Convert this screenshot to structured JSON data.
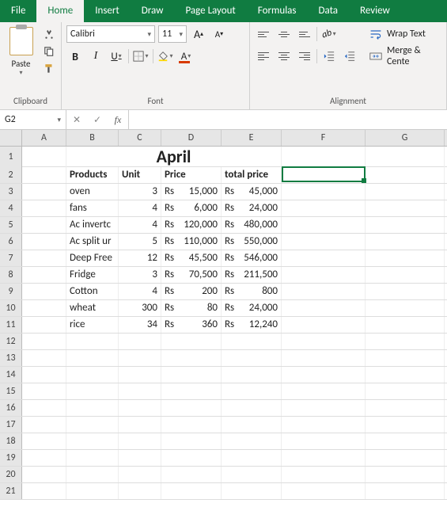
{
  "tabs": [
    "File",
    "Home",
    "Insert",
    "Draw",
    "Page Layout",
    "Formulas",
    "Data",
    "Review"
  ],
  "active_tab": 1,
  "clipboard": {
    "paste": "Paste",
    "label": "Clipboard"
  },
  "font": {
    "name": "Calibri",
    "size": "11",
    "label": "Font",
    "bold": "B",
    "italic": "I",
    "under": "U",
    "incA": "A",
    "decA": "A"
  },
  "alignment": {
    "label": "Alignment",
    "wrap": "Wrap Text",
    "merge": "Merge & Cente"
  },
  "namebox": "G2",
  "fx": "fx",
  "formula": "",
  "columns": [
    "A",
    "B",
    "C",
    "D",
    "E",
    "F",
    "G"
  ],
  "title": "April",
  "headers": {
    "products": "Products",
    "unit": "Unit",
    "price": "Price",
    "total": "total price"
  },
  "currency": "Rs",
  "rows": [
    {
      "product": "oven",
      "unit": "3",
      "price": "15,000",
      "total": "45,000"
    },
    {
      "product": "fans",
      "unit": "4",
      "price": "6,000",
      "total": "24,000"
    },
    {
      "product": "Ac invertor",
      "unit": "4",
      "price": "120,000",
      "total": "480,000"
    },
    {
      "product": "Ac split unit",
      "unit": "5",
      "price": "110,000",
      "total": "550,000"
    },
    {
      "product": "Deep Freezer",
      "unit": "12",
      "price": "45,500",
      "total": "546,000"
    },
    {
      "product": "Fridge",
      "unit": "3",
      "price": "70,500",
      "total": "211,500"
    },
    {
      "product": "Cotton",
      "unit": "4",
      "price": "200",
      "total": "800"
    },
    {
      "product": "wheat",
      "unit": "300",
      "price": "80",
      "total": "24,000"
    },
    {
      "product": "rice",
      "unit": "34",
      "price": "360",
      "total": "12,240"
    }
  ],
  "visible_products": [
    "oven",
    "fans",
    "Ac invertc",
    "Ac split ur",
    "Deep Free",
    "Fridge",
    "Cotton",
    "wheat",
    "rice"
  ]
}
